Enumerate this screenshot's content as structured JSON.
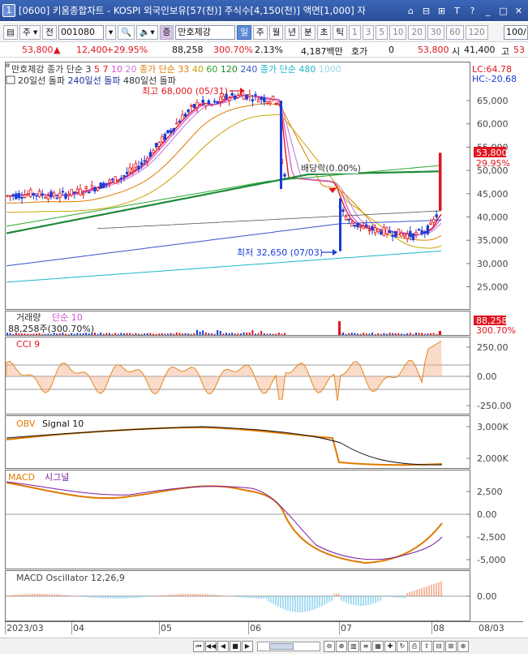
{
  "window": {
    "number": "1",
    "title": "[0600] 키움종합차트 - KOSPI 외국인보유[57(천)] 주식수[4,150(천)] 액면[1,000] 자",
    "buttons": [
      "⌂",
      "⊟",
      "⊞",
      "T",
      "?",
      "_",
      "□",
      "✕"
    ]
  },
  "toolbar": {
    "code_prefix": "주",
    "code_label": "전",
    "stock_code": "001080",
    "stock_name": "만호제강",
    "period_tabs": [
      "일",
      "주",
      "월",
      "년",
      "분",
      "초",
      "틱"
    ],
    "active_tab": "일",
    "interval_tabs": [
      "1",
      "3",
      "5",
      "10",
      "20",
      "30",
      "60",
      "120"
    ],
    "count_value": "100/"
  },
  "price_info": {
    "price": "53,800",
    "change": "12,400",
    "change_rate": "+29.95%",
    "volume": "88,258",
    "volume_rate": "300.70%",
    "turnover": "2.13%",
    "amount": "4,187백만",
    "quote_label": "호가",
    "quote_value": "0",
    "ask_price": "53,800",
    "open_label": "시",
    "open_price": "41,400",
    "high_label": "고",
    "high_trunc": "53"
  },
  "price_panel": {
    "legend_line1": [
      {
        "text": "만호제강",
        "color": "#333333"
      },
      {
        "text": "종가 단순 3",
        "color": "#333333"
      },
      {
        "text": "5",
        "color": "#e0161e"
      },
      {
        "text": "7",
        "color": "#e0161e"
      },
      {
        "text": "10",
        "color": "#d44fd4"
      },
      {
        "text": "20",
        "color": "#c77fd7"
      },
      {
        "text": "종가 단순 33",
        "color": "#e07a00"
      },
      {
        "text": "40",
        "color": "#c8a400"
      },
      {
        "text": "60",
        "color": "#2aa82a"
      },
      {
        "text": "120",
        "color": "#208820"
      },
      {
        "text": "240",
        "color": "#3655cc"
      },
      {
        "text": "종가 단순 480",
        "color": "#19b6c8"
      },
      {
        "text": "1000",
        "color": "#9ad6e6"
      }
    ],
    "legend_line2": [
      {
        "text": "20일선 돌파",
        "color": "#333333"
      },
      {
        "text": "240일선 돌파",
        "color": "#1f2f9f"
      },
      {
        "text": "480일선 돌파",
        "color": "#333333"
      }
    ],
    "lc": "LC:64.78",
    "hc": "HC:-20.68",
    "annotation_high": "최고 68,000 (05/31)",
    "annotation_low": "최저 32,650 (07/03)",
    "annotation_dividend": "배당락(0.00%)",
    "current_price_tag": "53,800",
    "current_rate_tag": "29.95%",
    "y_ticks": [
      "65,000",
      "60,000",
      "55,000",
      "50,000",
      "45,000",
      "40,000",
      "35,000",
      "30,000",
      "25,000"
    ]
  },
  "volume_panel": {
    "title": "거래량",
    "subtitle": "단순 10",
    "value_label": "88,258주(300.70%)",
    "tag_value": "88,258",
    "tag_rate": "300.70%"
  },
  "cci_panel": {
    "title": "CCI 9",
    "y_ticks": [
      "250.00",
      "0.00",
      "-250.00"
    ]
  },
  "obv_panel": {
    "title": "OBV",
    "signal": "Signal 10",
    "y_ticks": [
      "3,000K",
      "2,000K"
    ]
  },
  "macd_panel": {
    "title": "MACD",
    "signal": "시그널",
    "y_ticks": [
      "2,500",
      "0.00",
      "-2,500",
      "-5,000"
    ]
  },
  "osc_panel": {
    "title": "MACD Oscillator 12,26,9",
    "y_ticks": [
      "0.00"
    ]
  },
  "x_axis": {
    "labels": [
      "2023/03",
      "04",
      "05",
      "06",
      "07",
      "08",
      "08/03"
    ]
  },
  "colors": {
    "title_bar": "#2f56a6",
    "up": "#e0161e",
    "down": "#1a3ad6"
  }
}
